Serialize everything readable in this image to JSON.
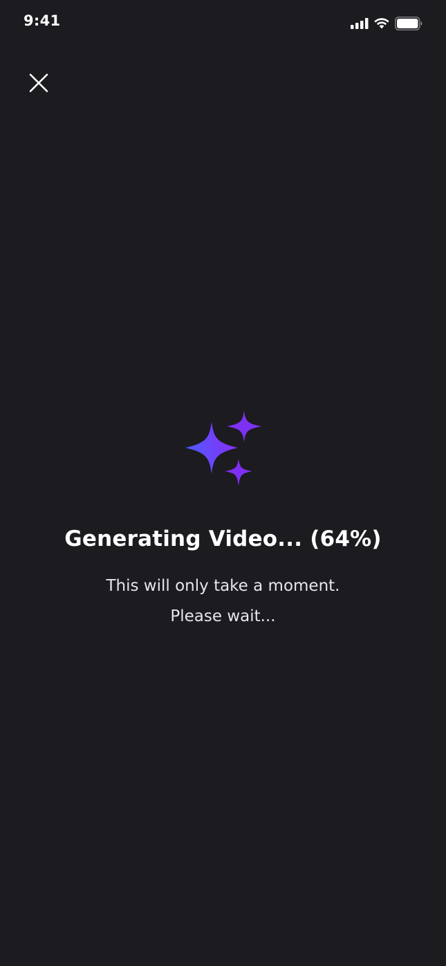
{
  "status_bar": {
    "time": "9:41",
    "icons": [
      "signal-icon",
      "wifi-icon",
      "battery-icon"
    ]
  },
  "header": {
    "close_icon": "close-icon"
  },
  "main": {
    "icon": "sparkle-icon",
    "title_text": "Generating Video...",
    "progress_label": "(64%)",
    "progress_fraction": 0.64,
    "subtitle_line1": "This will only take a moment.",
    "subtitle_line2": "Please wait..."
  },
  "colors": {
    "background": "#1b1b20",
    "text": "#ffffff",
    "accent_start": "#4f5cff",
    "accent_end": "#8b2cf5"
  }
}
